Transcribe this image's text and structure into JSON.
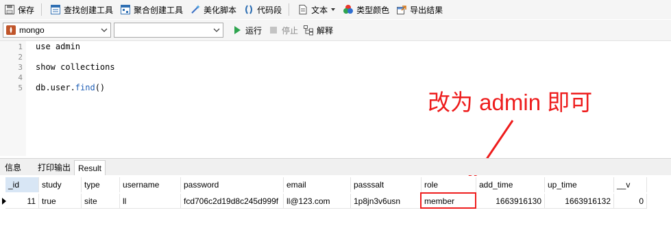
{
  "toolbar": {
    "save": "保存",
    "find_builder": "查找创建工具",
    "aggregate_builder": "聚合创建工具",
    "beautify": "美化脚本",
    "code_snippet": "代码段",
    "text": "文本",
    "type_color": "类型颜色",
    "export": "导出结果"
  },
  "query_bar": {
    "connection": "mongo",
    "database": "",
    "run": "运行",
    "stop": "停止",
    "explain": "解释"
  },
  "editor": {
    "line_numbers": [
      "1",
      "2",
      "3",
      "4",
      "5"
    ],
    "lines": [
      "use admin",
      "",
      "show collections",
      "",
      "db.user.find()"
    ],
    "find_prefix": "db.user.",
    "find_call": "find",
    "find_parens": "()"
  },
  "annotation": "改为 admin 即可",
  "tabs": [
    "信息",
    "打印输出",
    "Result"
  ],
  "active_tab": "Result",
  "grid": {
    "columns": [
      "_id",
      "study",
      "type",
      "username",
      "password",
      "email",
      "passsalt",
      "role",
      "add_time",
      "up_time",
      "__v"
    ],
    "rows": [
      [
        "11",
        "true",
        "site",
        "ll",
        "fcd706c2d19d8c245d999f",
        "ll@123.com",
        "1p8jn3v6usn",
        "member",
        "1663916130",
        "1663916132",
        "0"
      ]
    ]
  },
  "colors": {
    "annotation": "#ee1c1c",
    "run_icon": "#2ea44f",
    "keyword": "#1f5fb6"
  }
}
